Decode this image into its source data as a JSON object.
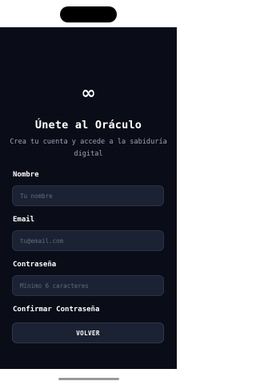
{
  "app": {
    "logo_symbol": "∞",
    "title": "Únete al Oráculo",
    "subtitle": "Crea tu cuenta y accede a la sabiduría digital"
  },
  "form": {
    "name": {
      "label": "Nombre",
      "placeholder": "Tu nombre"
    },
    "email": {
      "label": "Email",
      "placeholder": "tu@email.com"
    },
    "password": {
      "label": "Contraseña",
      "placeholder": "Mínimo 6 caracteres"
    },
    "confirm_password": {
      "label": "Confirmar Contraseña"
    }
  },
  "actions": {
    "back_label": "VOLVER"
  },
  "colors": {
    "background": "#0a0c17",
    "field_background": "#1b2233",
    "text": "#ffffff",
    "muted_text": "#9da3b4"
  }
}
